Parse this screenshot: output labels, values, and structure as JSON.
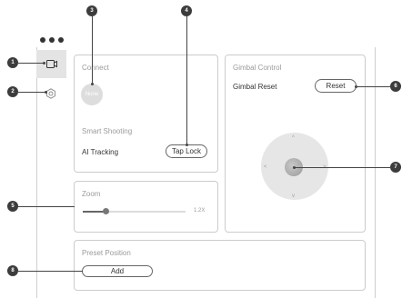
{
  "sidebar": {
    "menu_icon": "more-dots-icon",
    "items": [
      {
        "icon": "camera-icon",
        "selected": true
      },
      {
        "icon": "gear-icon",
        "selected": false
      }
    ]
  },
  "connect": {
    "title": "Connect",
    "device_label": "None",
    "section_title": "Smart Shooting",
    "feature_label": "AI Tracking",
    "button_label": "Tap Lock"
  },
  "zoom": {
    "title": "Zoom",
    "value_label": "1.2X",
    "slider_fraction": 0.22
  },
  "gimbal": {
    "title": "Gimbal Control",
    "reset_title": "Gimbal Reset",
    "reset_button": "Reset",
    "joystick_arrows": [
      "^",
      "<",
      ">",
      "v"
    ]
  },
  "preset": {
    "title": "Preset Position",
    "add_button": "Add"
  },
  "callouts": [
    "1",
    "2",
    "3",
    "4",
    "5",
    "6",
    "7",
    "8"
  ],
  "colors": {
    "callout": "#3c3c3c",
    "selected_bg": "#e4e4e4",
    "panel_border": "#cccccc"
  }
}
